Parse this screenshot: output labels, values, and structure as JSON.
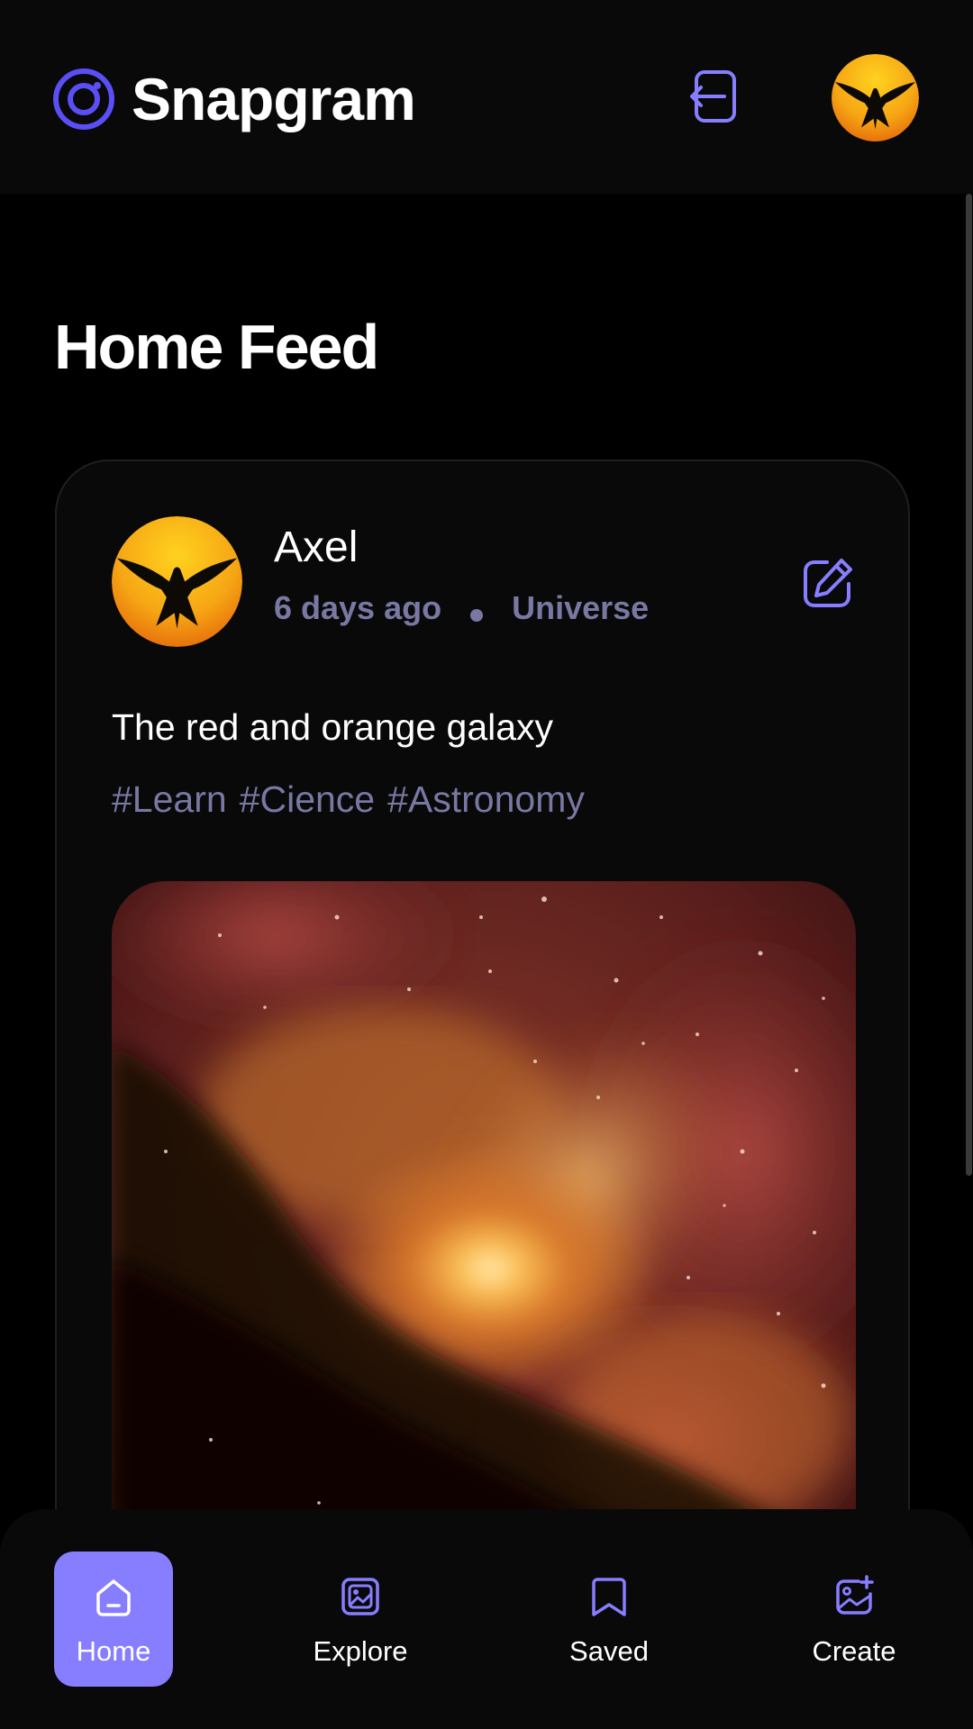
{
  "app": {
    "name": "Snapgram"
  },
  "header": {
    "logout_icon": "logout-icon",
    "avatar_icon": "user-avatar"
  },
  "main": {
    "title": "Home Feed"
  },
  "post": {
    "author": "Axel",
    "time": "6 days ago",
    "location": "Universe",
    "caption": "The red and orange galaxy",
    "tags": [
      "#Learn",
      "#Cience",
      "#Astronomy"
    ],
    "edit_icon": "edit-icon",
    "image_subject": "galaxy-image"
  },
  "bottom_nav": [
    {
      "label": "Home",
      "icon": "home-icon",
      "active": true
    },
    {
      "label": "Explore",
      "icon": "explore-icon",
      "active": false
    },
    {
      "label": "Saved",
      "icon": "bookmark-icon",
      "active": false
    },
    {
      "label": "Create",
      "icon": "create-post-icon",
      "active": false
    }
  ],
  "colors": {
    "accent": "#877eff",
    "muted": "#7878a3",
    "background": "#000000",
    "surface": "#09090a",
    "logo_ring": "#5a4ff5"
  }
}
